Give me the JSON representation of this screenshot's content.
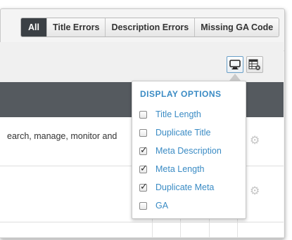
{
  "filters": {
    "all": "All",
    "title_errors": "Title Errors",
    "description_errors": "Description Errors",
    "missing_ga": "Missing GA Code",
    "active": "All"
  },
  "toolbar": {
    "display_icon": "monitor-icon",
    "columns_icon": "table-settings-icon"
  },
  "table": {
    "rows": [
      {
        "text": "earch, manage, monitor and"
      },
      {
        "text": ""
      }
    ]
  },
  "display_options": {
    "title": "DISPLAY OPTIONS",
    "items": [
      {
        "label": "Title Length",
        "checked": false
      },
      {
        "label": "Duplicate Title",
        "checked": false
      },
      {
        "label": "Meta Description",
        "checked": true
      },
      {
        "label": "Meta Length",
        "checked": true
      },
      {
        "label": "Duplicate Meta",
        "checked": true
      },
      {
        "label": "GA",
        "checked": false
      }
    ]
  },
  "colors": {
    "accent": "#3a8bc4",
    "header_dark": "#555a5f",
    "active_button": "#3b4045"
  }
}
